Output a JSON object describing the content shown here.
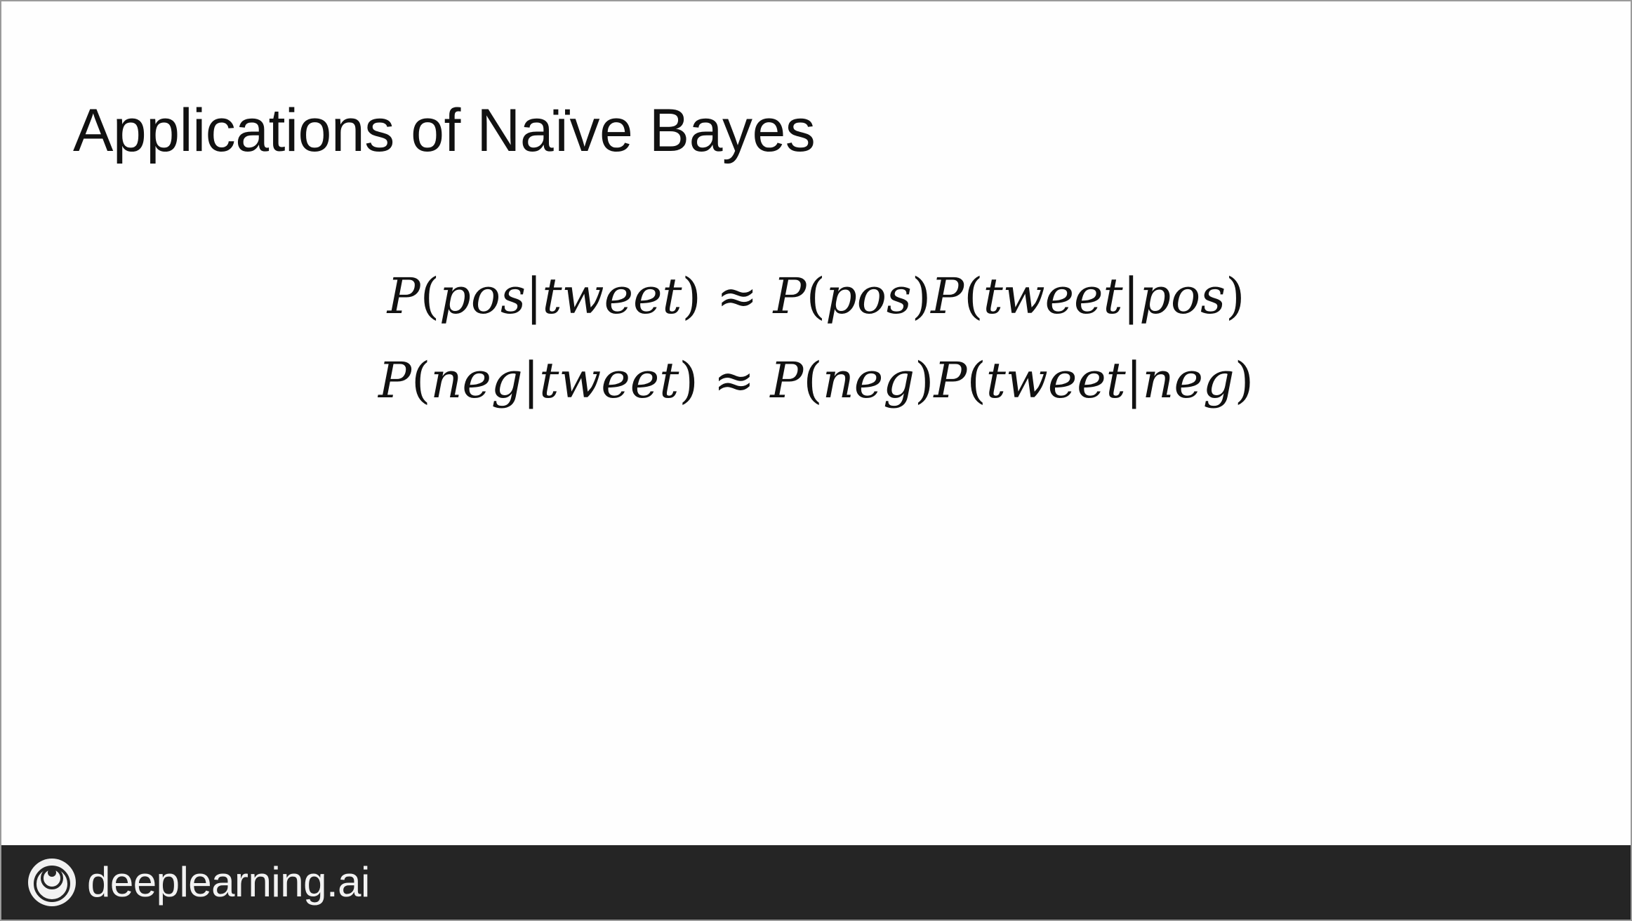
{
  "slide": {
    "title": "Applications of Naïve Bayes"
  },
  "equations": [
    {
      "lhs_prob": "P",
      "lhs_label": "pos",
      "lhs_given": "tweet",
      "relation": "≈",
      "prior_prob": "P",
      "prior_label": "pos",
      "like_prob": "P",
      "like_data": "tweet",
      "like_label": "pos"
    },
    {
      "lhs_prob": "P",
      "lhs_label": "neg",
      "lhs_given": "tweet",
      "relation": "≈",
      "prior_prob": "P",
      "prior_label": "neg",
      "like_prob": "P",
      "like_data": "tweet",
      "like_label": "neg"
    }
  ],
  "footer": {
    "brand": "deeplearning.ai",
    "logo_icon": "deeplearning-ai-logo-icon",
    "background_color": "#252525"
  }
}
